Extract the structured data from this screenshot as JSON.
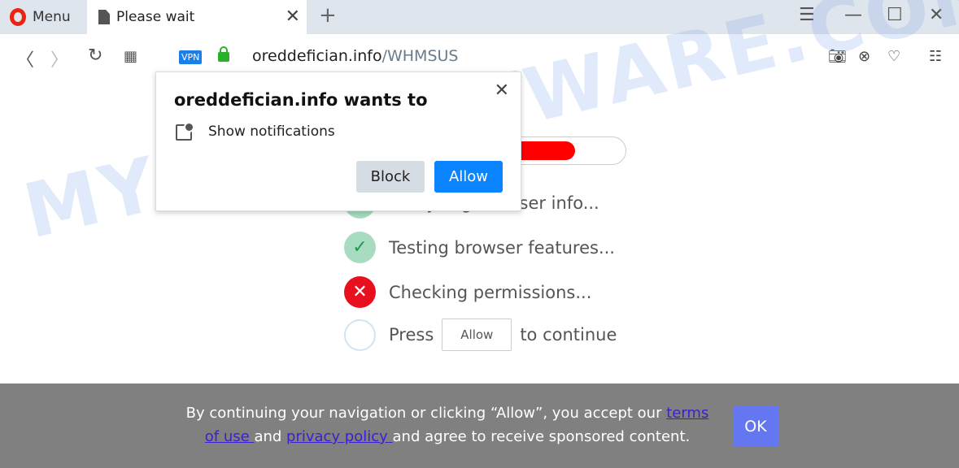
{
  "browser": {
    "menu_label": "Menu",
    "tab_title": "Please wait",
    "url_domain": "oreddefician.info",
    "url_path": "/WHMSUS",
    "vpn_badge": "VPN"
  },
  "page": {
    "watermark": "MYANTISPYWARE.COM",
    "progress_percent": 83,
    "steps": [
      {
        "text": "Analyzing browser info...",
        "status": "done"
      },
      {
        "text": "Testing browser features...",
        "status": "done"
      },
      {
        "text": "Checking permissions...",
        "status": "failed"
      }
    ],
    "press_label": "Press",
    "allow_box": "Allow",
    "continue_label": "to continue"
  },
  "popup": {
    "title": "oreddefician.info wants to",
    "permission": "Show notifications",
    "block": "Block",
    "allow": "Allow"
  },
  "banner": {
    "text_before": "By continuing your navigation or clicking “Allow”, you accept our ",
    "terms_link": "terms of use ",
    "text_mid": "and ",
    "privacy_link": "privacy policy ",
    "text_after": "and agree to receive sponsored content.",
    "ok": "OK"
  },
  "colors": {
    "accent": "#0a84ff",
    "progress": "#ff0000",
    "banner": "#808080",
    "ok_button": "#6577f0"
  }
}
